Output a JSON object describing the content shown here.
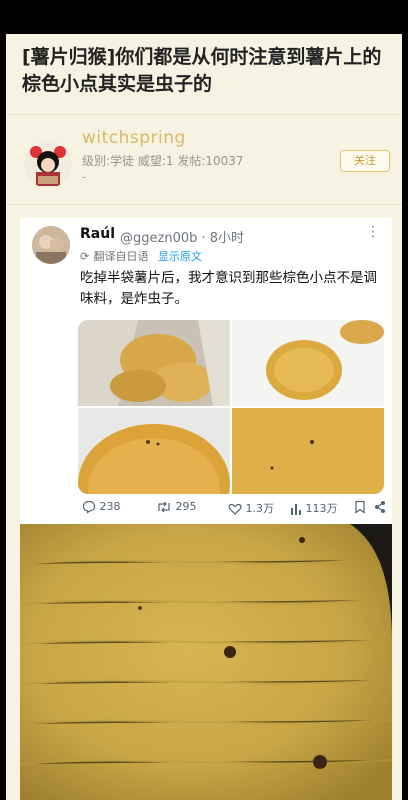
{
  "post": {
    "title": "[薯片归猴]你们都是从何时注意到薯片上的棕色小点其实是虫子的"
  },
  "author": {
    "name": "witchspring",
    "meta": "级别:学徒 威望:1 发帖:10037",
    "dash": "-",
    "follow_label": "关注"
  },
  "tweet": {
    "name": "Raúl",
    "handle": "@ggezn00b · 8小时",
    "more": "⋮",
    "translated_from": "翻译自日语",
    "show_original": "显示原文",
    "text": "吃掉半袋薯片后，我才意识到那些棕色小点不是调味料，是炸虫子。",
    "actions": {
      "replies": "238",
      "retweets": "295",
      "likes": "1.3万",
      "views": "113万"
    }
  },
  "colors": {
    "page_bg": "#f7f3e3",
    "author_name": "#d9b866",
    "link_blue": "#1d9bf0",
    "chip_gold": "#e0b257"
  },
  "icons": {
    "reply": "reply-icon",
    "retweet": "retweet-icon",
    "like": "heart-icon",
    "views": "views-icon",
    "bookmark": "bookmark-icon",
    "share": "share-icon"
  }
}
